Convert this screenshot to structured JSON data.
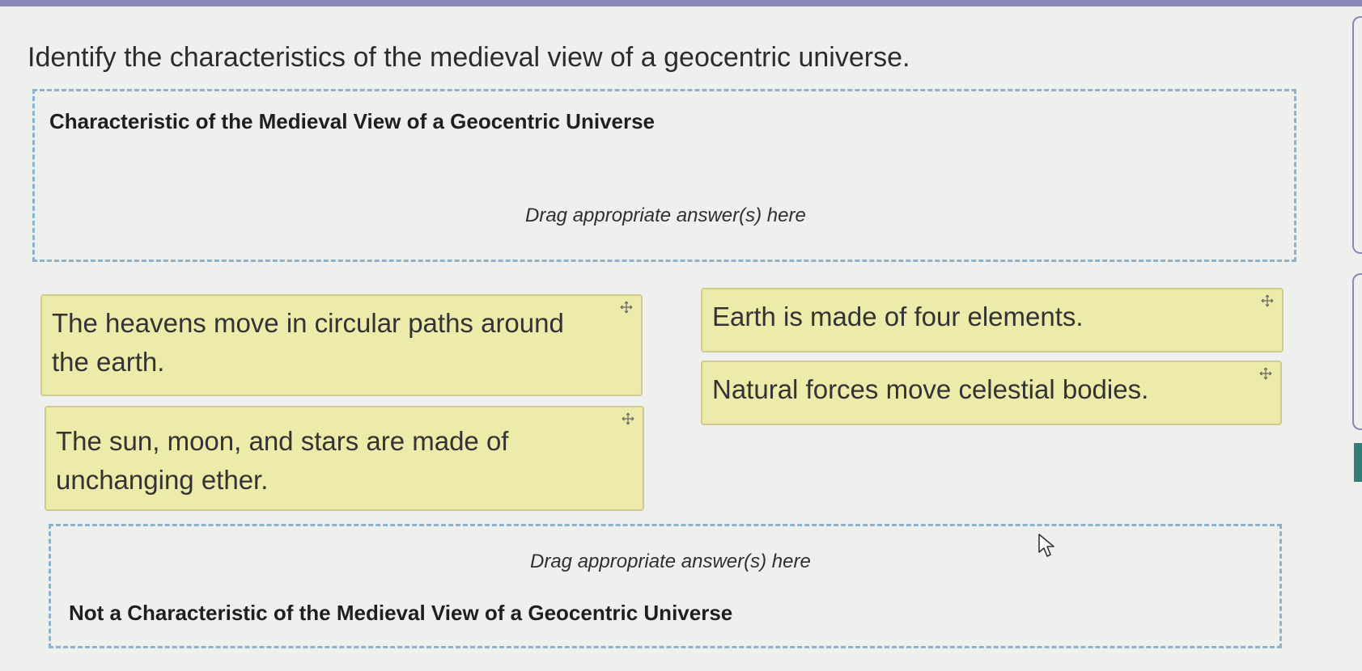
{
  "question": "Identify the characteristics of the medieval view of a geocentric universe.",
  "zones": {
    "top": {
      "heading": "Characteristic of the Medieval View of a Geocentric Universe",
      "hint": "Drag appropriate answer(s) here"
    },
    "bottom": {
      "heading": "Not a Characteristic of the Medieval View of a Geocentric Universe",
      "hint": "Drag appropriate answer(s) here"
    }
  },
  "cards": [
    {
      "text": "The heavens move in circular paths around\nthe earth.",
      "icon": "move-icon"
    },
    {
      "text": "The sun, moon, and stars are made of\nunchanging ether.",
      "icon": "move-icon"
    },
    {
      "text": "Earth is made of four elements.",
      "icon": "move-icon"
    },
    {
      "text": "Natural forces move celestial bodies.",
      "icon": "move-icon"
    }
  ],
  "colors": {
    "card_fill": "#ecebaa",
    "card_border": "#cfc98f",
    "dropzone_border": "#8fb1cc",
    "accent": "#8a86b8",
    "tab": "#2f7f76"
  },
  "cursor_icon": "arrow-cursor-icon"
}
